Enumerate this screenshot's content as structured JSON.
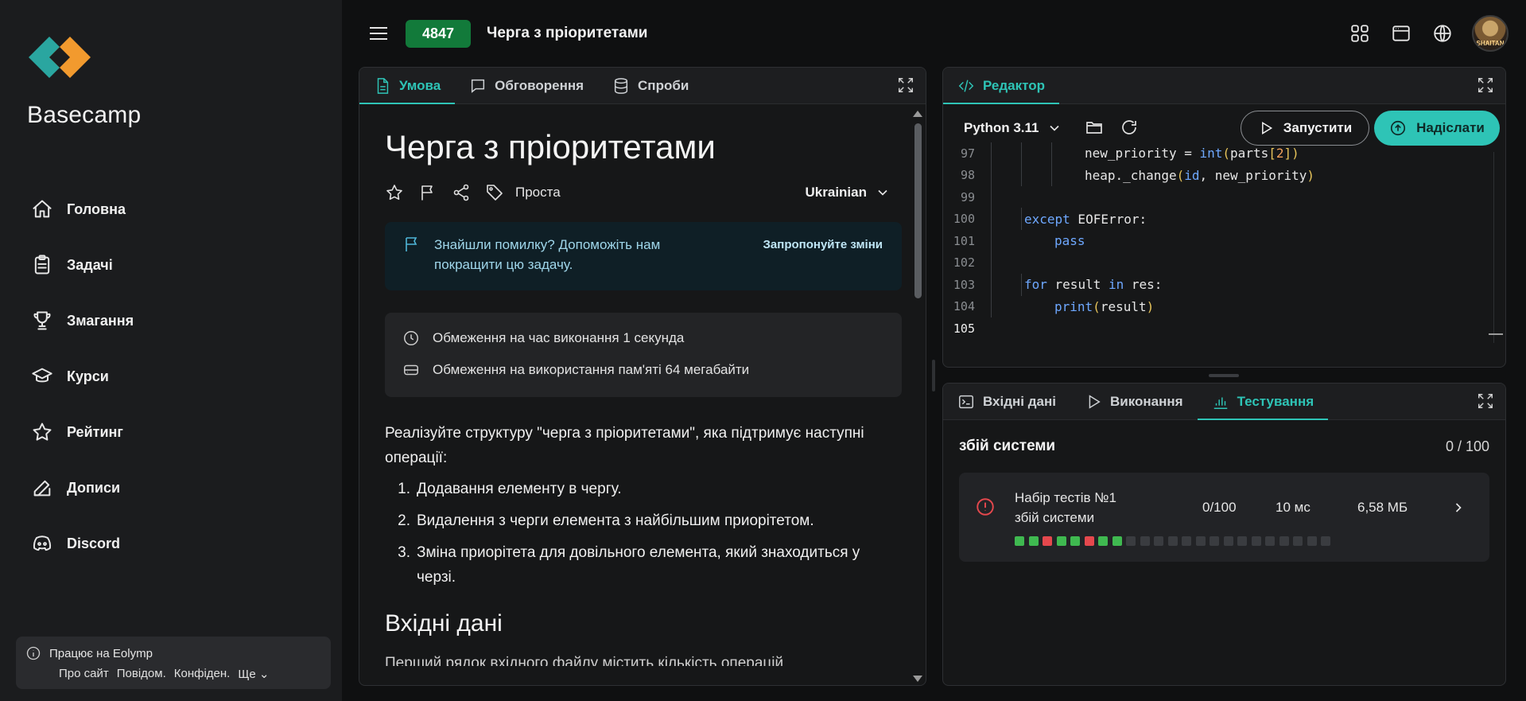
{
  "brand": {
    "name": "Basecamp"
  },
  "nav": [
    {
      "label": "Головна",
      "icon": "home-icon"
    },
    {
      "label": "Задачі",
      "icon": "clipboard-icon"
    },
    {
      "label": "Змагання",
      "icon": "trophy-icon"
    },
    {
      "label": "Курси",
      "icon": "graduation-cap-icon"
    },
    {
      "label": "Рейтинг",
      "icon": "star-icon"
    },
    {
      "label": "Дописи",
      "icon": "edit-icon"
    },
    {
      "label": "Discord",
      "icon": "discord-icon"
    }
  ],
  "footer": {
    "powered": "Працює на Eolymp",
    "links": [
      "Про сайт",
      "Повідом.",
      "Конфіден.",
      "Ще"
    ]
  },
  "topbar": {
    "problem_id": "4847",
    "problem_title": "Черга з пріоритетами",
    "avatar_text": "SHAITAN"
  },
  "problem_tabs": [
    {
      "label": "Умова",
      "icon": "document-icon"
    },
    {
      "label": "Обговорення",
      "icon": "chat-icon"
    },
    {
      "label": "Спроби",
      "icon": "database-icon"
    }
  ],
  "problem": {
    "title": "Черга з пріоритетами",
    "difficulty": "Проста",
    "language": "Ukrainian",
    "alert_text": "Знайшли помилку? Допоможіть нам покращити цю задачу.",
    "alert_link": "Запропонуйте зміни",
    "time_limit": "Обмеження на час виконання 1 секунда",
    "memory_limit": "Обмеження на використання пам'яті 64 мегабайти",
    "description": "Реалізуйте структуру \"черга з пріоритетами\", яка підтримує наступні операції:",
    "operations": [
      "Додавання елементу в чергу.",
      "Видалення з черги елемента з найбільшим приорітетом.",
      "Зміна приорітета для довільного елемента, який знаходиться у черзі."
    ],
    "input_heading": "Вхідні дані",
    "input_cut": "Перший рядок вхідного файлу містить кількість операцій"
  },
  "editor": {
    "tab_label": "Редактор",
    "language": "Python 3.11",
    "run_label": "Запустити",
    "submit_label": "Надіслати",
    "lines": [
      {
        "n": "97",
        "indent": 3,
        "code": "new_priority = int(parts[2])"
      },
      {
        "n": "98",
        "indent": 3,
        "code": "heap._change(id, new_priority)"
      },
      {
        "n": "99",
        "indent": 0,
        "code": ""
      },
      {
        "n": "100",
        "indent": 1,
        "code": "except EOFError:"
      },
      {
        "n": "101",
        "indent": 2,
        "code": "pass"
      },
      {
        "n": "102",
        "indent": 0,
        "code": ""
      },
      {
        "n": "103",
        "indent": 1,
        "code": "for result in res:"
      },
      {
        "n": "104",
        "indent": 2,
        "code": "print(result)"
      },
      {
        "n": "105",
        "indent": 0,
        "code": ""
      }
    ]
  },
  "bottom_tabs": [
    {
      "label": "Вхідні дані",
      "icon": "terminal-icon"
    },
    {
      "label": "Виконання",
      "icon": "play-icon"
    },
    {
      "label": "Тестування",
      "icon": "bar-chart-icon"
    }
  ],
  "testing": {
    "status": "збій системи",
    "score": "0 / 100",
    "set_name": "Набір тестів №1",
    "set_status": "збій системи",
    "set_score": "0/100",
    "set_time": "10 мс",
    "set_memory": "6,58 МБ",
    "results": [
      "pass",
      "pass",
      "fail",
      "pass",
      "pass",
      "fail",
      "pass",
      "pass",
      "pending",
      "pending",
      "pending",
      "pending",
      "pending",
      "pending",
      "pending",
      "pending",
      "pending",
      "pending",
      "pending",
      "pending",
      "pending",
      "pending",
      "pending"
    ]
  },
  "colors": {
    "accent": "#2ec4b6",
    "badge": "#127a3a",
    "pass": "#3fb950",
    "fail": "#e5484d",
    "pending": "#3a3c40"
  }
}
